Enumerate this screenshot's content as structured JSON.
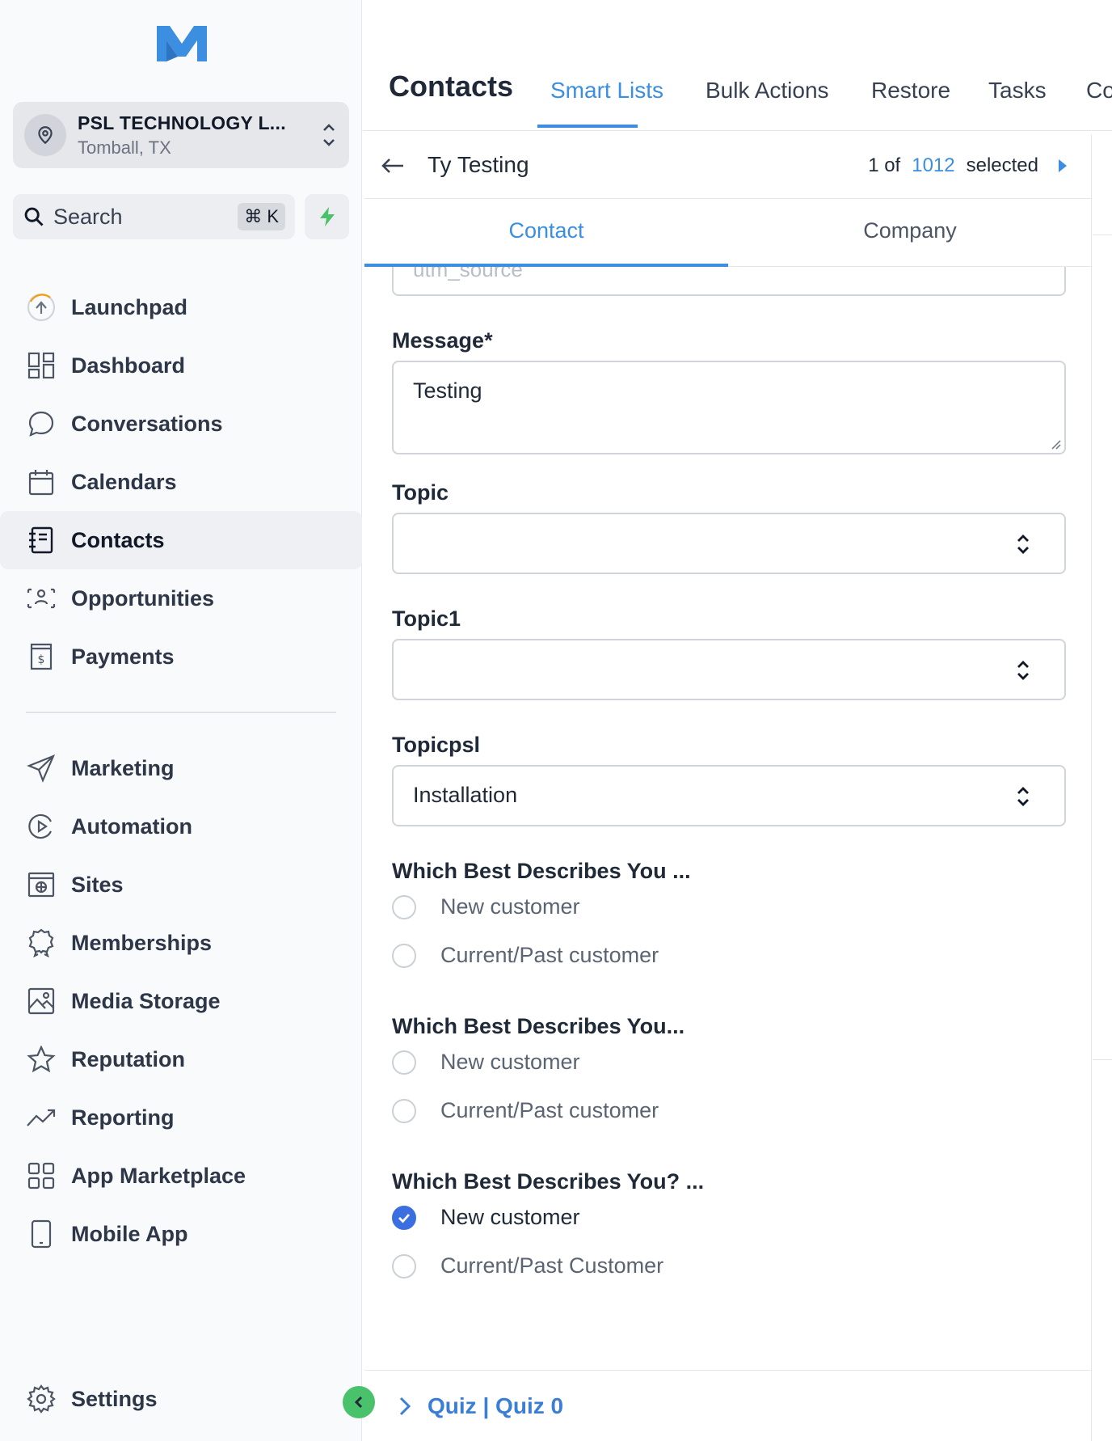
{
  "sidebar": {
    "account": {
      "name": "PSL TECHNOLOGY L...",
      "location": "Tomball, TX"
    },
    "search": {
      "label": "Search",
      "shortcut": "⌘ K"
    },
    "items": [
      {
        "label": "Launchpad",
        "icon": "rocket-icon"
      },
      {
        "label": "Dashboard",
        "icon": "dashboard-icon"
      },
      {
        "label": "Conversations",
        "icon": "chat-icon"
      },
      {
        "label": "Calendars",
        "icon": "calendar-icon"
      },
      {
        "label": "Contacts",
        "icon": "contacts-icon",
        "active": true
      },
      {
        "label": "Opportunities",
        "icon": "opportunities-icon"
      },
      {
        "label": "Payments",
        "icon": "payments-icon"
      }
    ],
    "items2": [
      {
        "label": "Marketing",
        "icon": "send-icon"
      },
      {
        "label": "Automation",
        "icon": "play-icon"
      },
      {
        "label": "Sites",
        "icon": "globe-icon"
      },
      {
        "label": "Memberships",
        "icon": "badge-icon"
      },
      {
        "label": "Media Storage",
        "icon": "image-icon"
      },
      {
        "label": "Reputation",
        "icon": "star-icon"
      },
      {
        "label": "Reporting",
        "icon": "trend-icon"
      },
      {
        "label": "App Marketplace",
        "icon": "apps-icon"
      },
      {
        "label": "Mobile App",
        "icon": "phone-icon"
      }
    ],
    "settings_label": "Settings"
  },
  "topbar": {
    "title": "Contacts",
    "tabs": [
      "Smart Lists",
      "Bulk Actions",
      "Restore",
      "Tasks",
      "Co"
    ]
  },
  "detail": {
    "contact_name": "Ty Testing",
    "pager": {
      "prefix": "1 of",
      "total": "1012",
      "suffix": "selected"
    },
    "tabs": [
      "Contact",
      "Company"
    ]
  },
  "form": {
    "ghost_value": "utm_source",
    "message": {
      "label": "Message*",
      "value": "Testing"
    },
    "topic": {
      "label": "Topic",
      "value": ""
    },
    "topic1": {
      "label": "Topic1",
      "value": ""
    },
    "topicpsl": {
      "label": "Topicpsl",
      "value": "Installation"
    },
    "groups": [
      {
        "label": "Which Best Describes You ...",
        "options": [
          "New customer",
          "Current/Past customer"
        ],
        "selected": -1
      },
      {
        "label": "Which Best Describes You...",
        "options": [
          "New customer",
          "Current/Past customer"
        ],
        "selected": -1
      },
      {
        "label": "Which Best Describes You? ...",
        "options": [
          "New customer",
          "Current/Past Customer"
        ],
        "selected": 0
      }
    ]
  },
  "quiz": {
    "label": "Quiz | Quiz 0"
  },
  "colors": {
    "accent": "#3b8ee0",
    "check": "#3b6fe0",
    "green": "#4ac26b"
  }
}
